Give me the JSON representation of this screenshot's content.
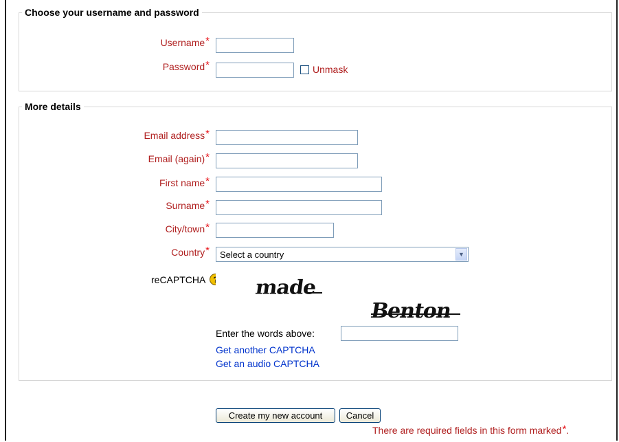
{
  "section1": {
    "legend": "Choose your username and password",
    "username_label": "Username",
    "password_label": "Password",
    "unmask_label": "Unmask",
    "username_value": "",
    "password_value": ""
  },
  "section2": {
    "legend": "More details",
    "email_label": "Email address",
    "email_again_label": "Email (again)",
    "first_name_label": "First name",
    "surname_label": "Surname",
    "city_label": "City/town",
    "country_label": "Country",
    "country_selected": "Select a country",
    "recaptcha_label": "reCAPTCHA",
    "help_glyph": "?",
    "captcha_word1": "made",
    "captcha_word2": "Benton",
    "enter_words_label": "Enter the words above:",
    "another_captcha_link": "Get another CAPTCHA",
    "audio_captcha_link": "Get an audio CAPTCHA"
  },
  "required_marker": "*",
  "buttons": {
    "create": "Create my new account",
    "cancel": "Cancel"
  },
  "required_note": "There are required fields in this form marked",
  "required_note_end": ".",
  "colors": {
    "label_red": "#b01f1f",
    "asterisk_red": "#e8141b",
    "link_blue": "#0033cc",
    "input_border": "#7f9db9"
  }
}
